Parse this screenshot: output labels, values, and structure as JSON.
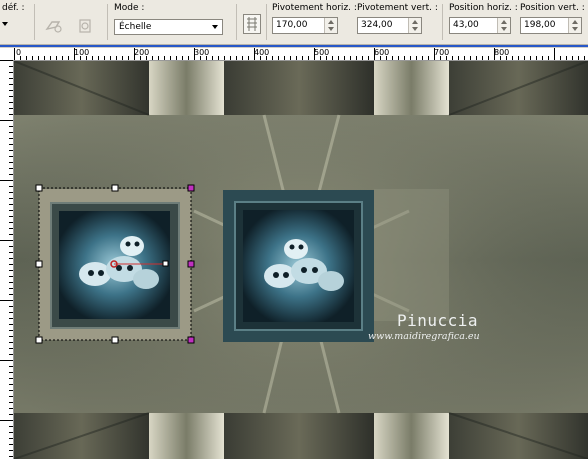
{
  "toolbar": {
    "preset_label": "déf. :",
    "mode_label": "Mode :",
    "mode_value": "Échelle",
    "pivot_h_label": "Pivotement horiz. :",
    "pivot_h_value": "170,00",
    "pivot_v_label": "Pivotement vert. :",
    "pivot_v_value": "324,00",
    "pos_h_label": "Position horiz. :",
    "pos_h_value": "43,00",
    "pos_v_label": "Position vert. :",
    "pos_v_value": "198,00"
  },
  "ruler": {
    "h_labels": [
      "0",
      "100",
      "200",
      "300",
      "400",
      "500",
      "600",
      "700",
      "800"
    ]
  },
  "watermark": {
    "name": "Pinuccia",
    "url": "www.maidiregrafica.eu"
  },
  "colors": {
    "toolbar_bg": "#ece9e1",
    "accent_line": "#2858c8",
    "frame_dark": "#2c4a52",
    "frame_light": "#9c9a86",
    "canvas_base": "#6a6c5e"
  }
}
